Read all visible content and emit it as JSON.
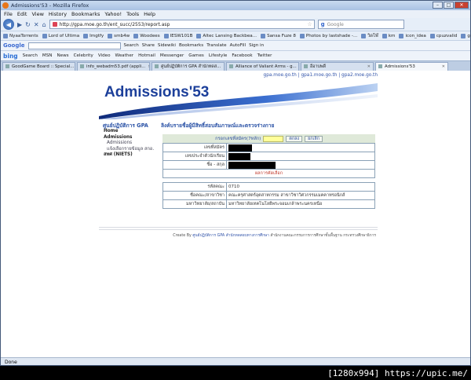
{
  "window": {
    "title": "Admissions'53 - Mozilla Firefox",
    "min": "–",
    "max": "□",
    "close": "✕"
  },
  "menu": [
    "File",
    "Edit",
    "View",
    "History",
    "Bookmarks",
    "Yahoo!",
    "Tools",
    "Help"
  ],
  "nav": {
    "url": "http://gpa.moe.go.th/ent_succ/2553/report.asp",
    "search_placeholder": "Google"
  },
  "bookmarks": [
    "NyaaTorrents",
    "Lord of Ultima",
    "Imgtfy",
    "smb4w",
    "Woodees",
    "IESW101B",
    "Altec Lansing Backbea...",
    "Sansa Fuze 8",
    "Photos by lastshade -...",
    "วิดโพ๊",
    "km",
    "icon_idea",
    "cpuzvalid",
    "gpuzvalid"
  ],
  "google_toolbar": {
    "logo": "Google",
    "items": [
      "Search",
      "Share",
      "Sidewiki",
      "Bookmarks",
      "Translate",
      "AutoFill",
      "Sign in"
    ]
  },
  "bing_toolbar": {
    "logo": "bing",
    "items": [
      "Search",
      "MSN",
      "News",
      "Celebrity",
      "Video",
      "Weather",
      "Hotmail",
      "Messenger",
      "Games",
      "Lifestyle",
      "Facebook",
      "Twitter"
    ]
  },
  "tabs": [
    {
      "label": "GoodGame Board :: Special..."
    },
    {
      "label": "info_webadm53.pdf (appli..."
    },
    {
      "label": "ศูนย์ปฏิบัติการ GPA สำนักทดส..."
    },
    {
      "label": "Alliance of Valiant Arms - g..."
    },
    {
      "label": "อีอาบพดี"
    },
    {
      "label": "Admissions'53"
    }
  ],
  "page": {
    "top_links": "gpa.moe.go.th | gpa1.moe.go.th | gpa2.moe.go.th",
    "banner_title": "Admissions'53",
    "side_title": "ศูนย์ปฏิบัติการ GPA",
    "page_title": "ลิงค์บรายชื่อผู้มีสิทธิ์สอบสัมภาษณ์และตรวจร่างกาย",
    "nav": {
      "home": "Home",
      "admissions": "Admissions",
      "admissions_sub1": "Admissions",
      "admissions_sub2": "แจ้งเลือกรายข้อมูล สกอ.",
      "niets": "สทศ (NIETS)"
    },
    "form": {
      "label": "กรอกเลขที่สมัคร(7หลัก)",
      "input_value": "",
      "submit": "ตกลง",
      "cancel": "ยกเลิก"
    },
    "rows": {
      "applicant_no": "เลขที่สมัคร",
      "student_id": "เลขประจำตัวนักเรียน",
      "name": "ชื่อ - สกุล",
      "result": "ผลการคัดเลือก",
      "code_label": "รหัสคณะ",
      "code_value": "0710",
      "faculty_label": "ชื่อคณะ/สาขาวิชา",
      "faculty_value": "คณะครุศาสตร์อุตสาหกรรม สาขาวิชาวิศวกรรมเมคคาทรอนิกส์",
      "university_label": "มหาวิทยาลัย/สถาบัน",
      "university_value": "มหาวิทยาลัยเทคโนโลยีพระจอมเกล้าพระนครเหนือ"
    },
    "footer_prefix": "Create By",
    "footer_link": "ศูนย์ปฏิบัติการ GPA สำนักทดสอบทางการศึกษา",
    "footer_rest": "สำนักงานคณะกรรมการการศึกษาขั้นพื้นฐาน กระทรวงศึกษาธิการ"
  },
  "status": "Done",
  "watermark": "[1280x994] https://upic.me/",
  "colors": {
    "accent": "#1c3f9a",
    "result_red": "#c0392b",
    "form_bg": "#dfe9d9",
    "input_yellow": "#ffff99"
  }
}
